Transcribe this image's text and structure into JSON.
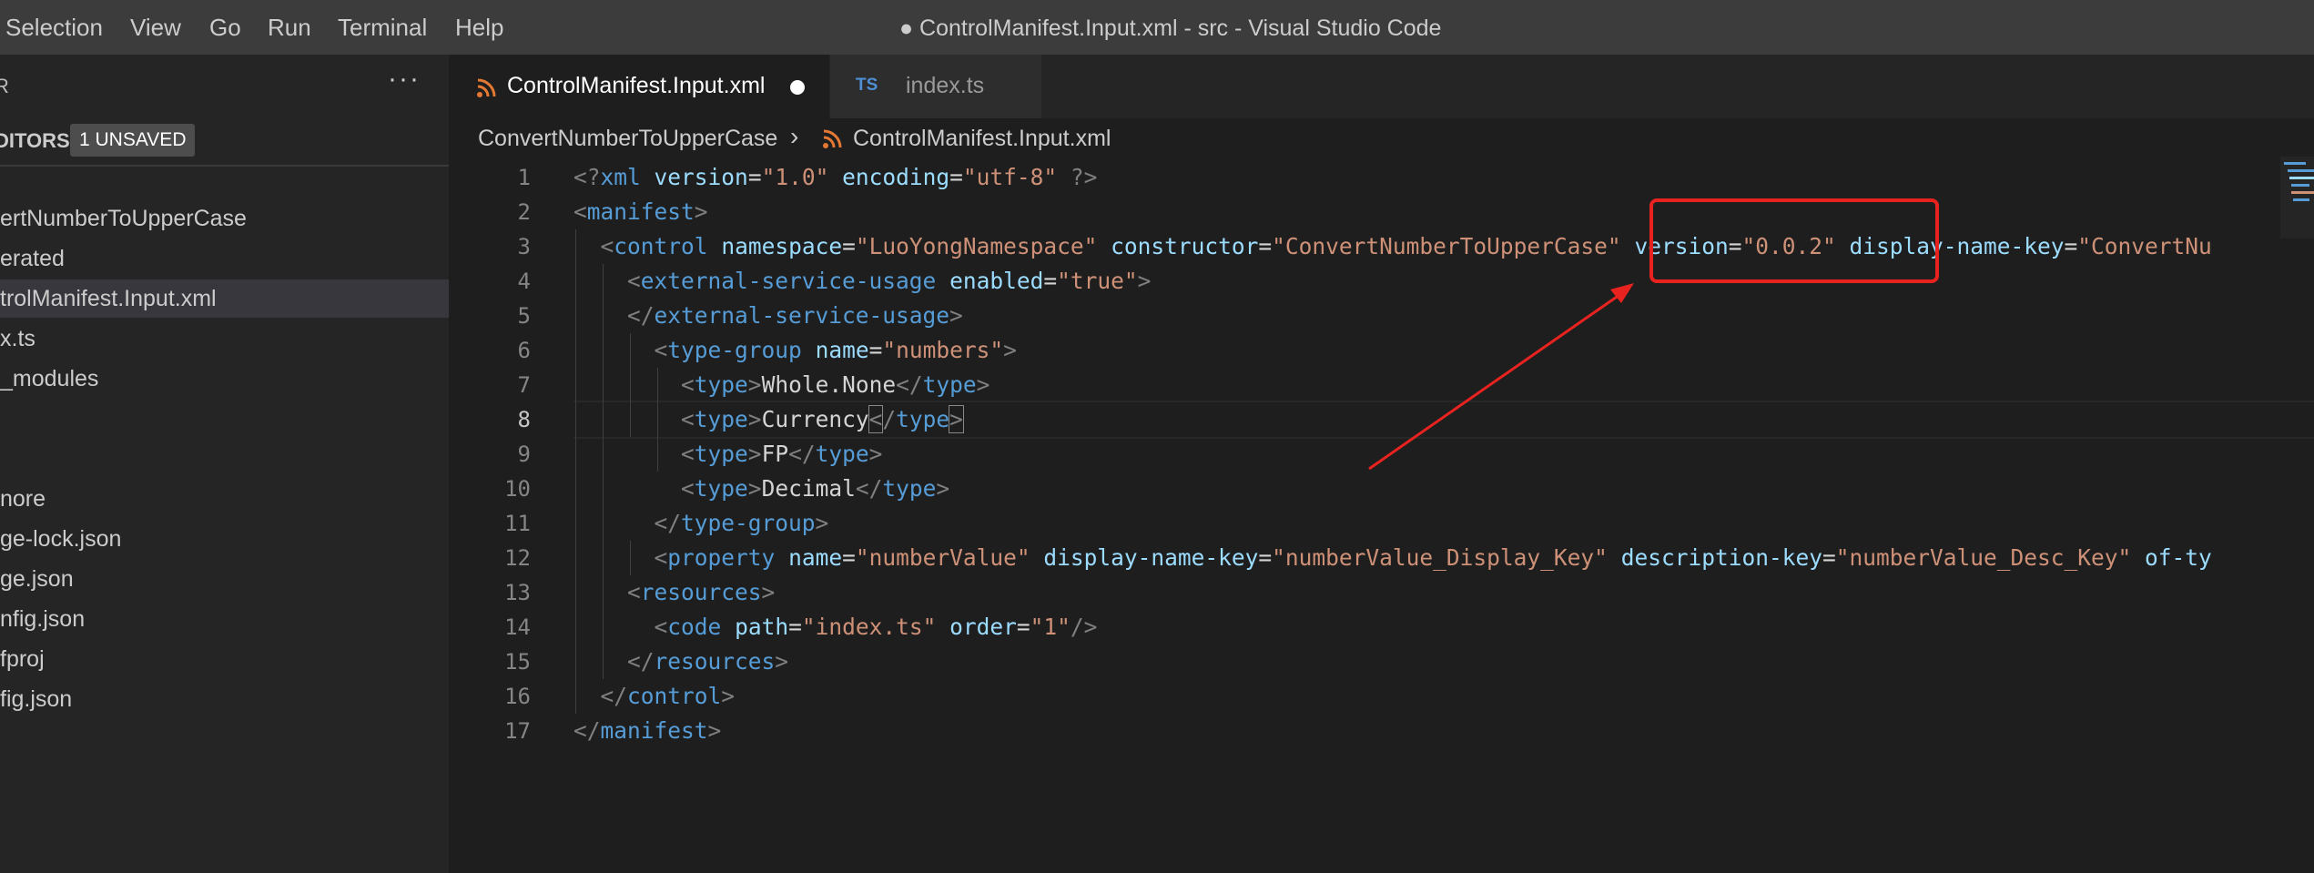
{
  "window": {
    "title": "● ControlManifest.Input.xml - src - Visual Studio Code"
  },
  "menu": {
    "items": [
      "Selection",
      "View",
      "Go",
      "Run",
      "Terminal",
      "Help"
    ]
  },
  "sidebar": {
    "section_title": "R",
    "more_icon": "ellipsis-icon",
    "open_editors_label": "DITORS",
    "unsaved_badge": "1 UNSAVED",
    "items": [
      {
        "label": "ertNumberToUpperCase"
      },
      {
        "label": "erated"
      },
      {
        "label": "trolManifest.Input.xml",
        "selected": true
      },
      {
        "label": "x.ts"
      },
      {
        "label": "_modules"
      },
      {
        "label": "nore"
      },
      {
        "label": "ge-lock.json"
      },
      {
        "label": "ge.json"
      },
      {
        "label": "nfig.json"
      },
      {
        "label": "fproj"
      },
      {
        "label": "fig.json"
      }
    ]
  },
  "tabs": [
    {
      "label": "ControlManifest.Input.xml",
      "icon": "rss-icon",
      "active": true,
      "dirty": true
    },
    {
      "label": "index.ts",
      "icon_text": "TS",
      "active": false
    }
  ],
  "breadcrumb": {
    "folder": "ConvertNumberToUpperCase",
    "file": "ControlManifest.Input.xml"
  },
  "editor": {
    "active_line": 8,
    "lines": [
      {
        "n": "1",
        "tokens": [
          [
            "p",
            "<?"
          ],
          [
            "t",
            "xml"
          ],
          [
            "x",
            " "
          ],
          [
            "a",
            "version"
          ],
          [
            "x",
            "="
          ],
          [
            "s",
            "\"1.0\""
          ],
          [
            "x",
            " "
          ],
          [
            "a",
            "encoding"
          ],
          [
            "x",
            "="
          ],
          [
            "s",
            "\"utf-8\""
          ],
          [
            "x",
            " "
          ],
          [
            "p",
            "?>"
          ]
        ]
      },
      {
        "n": "2",
        "tokens": [
          [
            "p",
            "<"
          ],
          [
            "t",
            "manifest"
          ],
          [
            "p",
            ">"
          ]
        ]
      },
      {
        "n": "3",
        "tokens": [
          [
            "x",
            "  "
          ],
          [
            "p",
            "<"
          ],
          [
            "t",
            "control"
          ],
          [
            "x",
            " "
          ],
          [
            "a",
            "namespace"
          ],
          [
            "x",
            "="
          ],
          [
            "s",
            "\"LuoYongNamespace\""
          ],
          [
            "x",
            " "
          ],
          [
            "a",
            "constructor"
          ],
          [
            "x",
            "="
          ],
          [
            "s",
            "\"ConvertNumberToUpperCase\""
          ],
          [
            "x",
            " "
          ],
          [
            "a",
            "version"
          ],
          [
            "x",
            "="
          ],
          [
            "s",
            "\"0.0.2\""
          ],
          [
            "x",
            " "
          ],
          [
            "a",
            "display-name-key"
          ],
          [
            "x",
            "="
          ],
          [
            "s",
            "\"ConvertNu"
          ]
        ]
      },
      {
        "n": "4",
        "tokens": [
          [
            "x",
            "    "
          ],
          [
            "p",
            "<"
          ],
          [
            "t",
            "external-service-usage"
          ],
          [
            "x",
            " "
          ],
          [
            "a",
            "enabled"
          ],
          [
            "x",
            "="
          ],
          [
            "s",
            "\"true\""
          ],
          [
            "p",
            ">"
          ]
        ]
      },
      {
        "n": "5",
        "tokens": [
          [
            "x",
            "    "
          ],
          [
            "p",
            "</"
          ],
          [
            "t",
            "external-service-usage"
          ],
          [
            "p",
            ">"
          ]
        ]
      },
      {
        "n": "6",
        "tokens": [
          [
            "x",
            "      "
          ],
          [
            "p",
            "<"
          ],
          [
            "t",
            "type-group"
          ],
          [
            "x",
            " "
          ],
          [
            "a",
            "name"
          ],
          [
            "x",
            "="
          ],
          [
            "s",
            "\"numbers\""
          ],
          [
            "p",
            ">"
          ]
        ]
      },
      {
        "n": "7",
        "tokens": [
          [
            "x",
            "        "
          ],
          [
            "p",
            "<"
          ],
          [
            "t",
            "type"
          ],
          [
            "p",
            ">"
          ],
          [
            "x",
            "Whole.None"
          ],
          [
            "p",
            "</"
          ],
          [
            "t",
            "type"
          ],
          [
            "p",
            ">"
          ]
        ]
      },
      {
        "n": "8",
        "tokens": [
          [
            "x",
            "        "
          ],
          [
            "p",
            "<"
          ],
          [
            "t",
            "type"
          ],
          [
            "p",
            ">"
          ],
          [
            "x",
            "Currency"
          ],
          [
            "c",
            "<"
          ],
          [
            "p",
            "/"
          ],
          [
            "t",
            "type"
          ],
          [
            "c",
            ">"
          ]
        ]
      },
      {
        "n": "9",
        "tokens": [
          [
            "x",
            "        "
          ],
          [
            "p",
            "<"
          ],
          [
            "t",
            "type"
          ],
          [
            "p",
            ">"
          ],
          [
            "x",
            "FP"
          ],
          [
            "p",
            "</"
          ],
          [
            "t",
            "type"
          ],
          [
            "p",
            ">"
          ]
        ]
      },
      {
        "n": "10",
        "tokens": [
          [
            "x",
            "        "
          ],
          [
            "p",
            "<"
          ],
          [
            "t",
            "type"
          ],
          [
            "p",
            ">"
          ],
          [
            "x",
            "Decimal"
          ],
          [
            "p",
            "</"
          ],
          [
            "t",
            "type"
          ],
          [
            "p",
            ">"
          ]
        ]
      },
      {
        "n": "11",
        "tokens": [
          [
            "x",
            "      "
          ],
          [
            "p",
            "</"
          ],
          [
            "t",
            "type-group"
          ],
          [
            "p",
            ">"
          ]
        ]
      },
      {
        "n": "12",
        "tokens": [
          [
            "x",
            "      "
          ],
          [
            "p",
            "<"
          ],
          [
            "t",
            "property"
          ],
          [
            "x",
            " "
          ],
          [
            "a",
            "name"
          ],
          [
            "x",
            "="
          ],
          [
            "s",
            "\"numberValue\""
          ],
          [
            "x",
            " "
          ],
          [
            "a",
            "display-name-key"
          ],
          [
            "x",
            "="
          ],
          [
            "s",
            "\"numberValue_Display_Key\""
          ],
          [
            "x",
            " "
          ],
          [
            "a",
            "description-key"
          ],
          [
            "x",
            "="
          ],
          [
            "s",
            "\"numberValue_Desc_Key\""
          ],
          [
            "x",
            " "
          ],
          [
            "a",
            "of-ty"
          ]
        ]
      },
      {
        "n": "13",
        "tokens": [
          [
            "x",
            "    "
          ],
          [
            "p",
            "<"
          ],
          [
            "t",
            "resources"
          ],
          [
            "p",
            ">"
          ]
        ]
      },
      {
        "n": "14",
        "tokens": [
          [
            "x",
            "      "
          ],
          [
            "p",
            "<"
          ],
          [
            "t",
            "code"
          ],
          [
            "x",
            " "
          ],
          [
            "a",
            "path"
          ],
          [
            "x",
            "="
          ],
          [
            "s",
            "\"index.ts\""
          ],
          [
            "x",
            " "
          ],
          [
            "a",
            "order"
          ],
          [
            "x",
            "="
          ],
          [
            "s",
            "\"1\""
          ],
          [
            "p",
            "/>"
          ]
        ]
      },
      {
        "n": "15",
        "tokens": [
          [
            "x",
            "    "
          ],
          [
            "p",
            "</"
          ],
          [
            "t",
            "resources"
          ],
          [
            "p",
            ">"
          ]
        ]
      },
      {
        "n": "16",
        "tokens": [
          [
            "x",
            "  "
          ],
          [
            "p",
            "</"
          ],
          [
            "t",
            "control"
          ],
          [
            "p",
            ">"
          ]
        ]
      },
      {
        "n": "17",
        "tokens": [
          [
            "p",
            "</"
          ],
          [
            "t",
            "manifest"
          ],
          [
            "p",
            ">"
          ]
        ]
      }
    ]
  },
  "annotation": {
    "color": "#e8231f",
    "highlight_target": "version=\"0.0.2\""
  }
}
